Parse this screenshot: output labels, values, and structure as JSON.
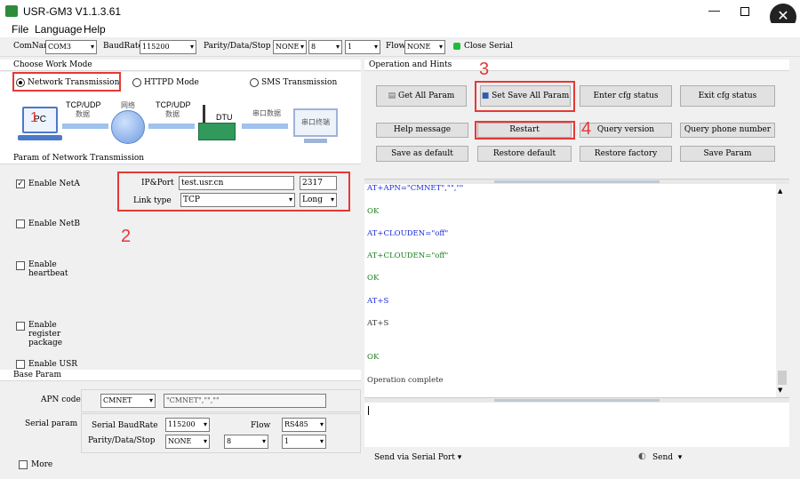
{
  "window": {
    "title": "USR-GM3 V1.1.3.61"
  },
  "menu": [
    "File",
    "Language",
    "Help"
  ],
  "toolbar": {
    "com_label": "ComName",
    "com_value": "COM3",
    "baud_label": "BaudRate",
    "baud_value": "115200",
    "parity_label": "Parity/Data/Stop",
    "parity_value": "NONE",
    "data_value": "8",
    "stop_value": "1",
    "flow_label": "Flow",
    "flow_value": "NONE",
    "close_label": "Close Serial",
    "status_color": "#1fbd3b"
  },
  "left": {
    "work_mode_title": "Choose Work Mode",
    "modes": [
      "Network Transmission",
      "HTTPD Mode",
      "SMS Transmission"
    ],
    "diagram": {
      "pc": "PC",
      "tcp1": "TCP/UDP",
      "data1": "数据",
      "net": "网络",
      "tcp2": "TCP/UDP",
      "data2": "数据",
      "dtu": "DTU",
      "serial_data": "串口数据",
      "terminal": "串口终端"
    },
    "netparam_title": "Param of Network Transmission",
    "enable_neta": "Enable NetA",
    "enable_netb": "Enable NetB",
    "enable_heartbeat": "Enable\nheartbeat",
    "enable_register": "Enable\nregister\npackage",
    "enable_usr": "Enable USR",
    "ipport_label": "IP&Port",
    "ip_value": "test.usr.cn",
    "port_value": "2317",
    "linktype_label": "Link type",
    "linktype_value": "TCP",
    "linktype_mode": "Long",
    "base_title": "Base Param",
    "apn_label": "APN code",
    "apn_value": "CMNET",
    "apn_text": "\"CMNET\",\"\",\"\"",
    "serial_label": "Serial param",
    "serial_baud_label": "Serial BaudRate",
    "serial_baud_value": "115200",
    "flow_label": "Flow",
    "flow_value": "RS485",
    "pds_label": "Parity/Data/Stop",
    "pds_parity": "NONE",
    "pds_data": "8",
    "pds_stop": "1",
    "more_label": "More"
  },
  "right": {
    "ops_title": "Operation and Hints",
    "get_all": "Get All Param",
    "set_save": "Set Save All Param",
    "enter_cfg": "Enter cfg status",
    "exit_cfg": "Exit cfg status",
    "help": "Help message",
    "restart": "Restart",
    "query_version": "Query version",
    "query_phone": "Query phone number",
    "save_default": "Save as default",
    "restore_default": "Restore default",
    "restore_factory": "Restore factory",
    "save_param": "Save Param",
    "console": [
      {
        "text": "AT+APN=\"CMNET\",\"\",\"\"",
        "cls": "blue"
      },
      {
        "text": "OK",
        "cls": "green"
      },
      {
        "text": "AT+CLOUDEN=\"off\"",
        "cls": "blue"
      },
      {
        "text": "AT+CLOUDEN=\"off\"",
        "cls": "green"
      },
      {
        "text": "OK",
        "cls": "green"
      },
      {
        "text": "AT+S",
        "cls": "blue"
      },
      {
        "text": "AT+S",
        "cls": "dark"
      },
      {
        "text": "OK",
        "cls": "green"
      },
      {
        "text": "Operation complete",
        "cls": "dark"
      }
    ],
    "send_via": "Send via Serial Port",
    "send": "Send"
  },
  "annotations": [
    "1",
    "2",
    "3",
    "4"
  ]
}
